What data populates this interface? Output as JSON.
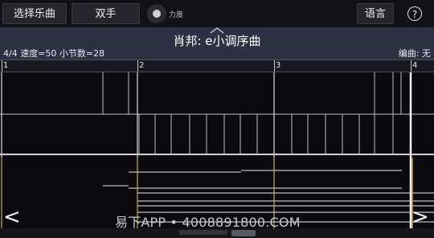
{
  "toolbar": {
    "select_song": "选择乐曲",
    "hands": "双手",
    "force_label": "力度",
    "language": "语言",
    "help": "?"
  },
  "song": {
    "title": "肖邦: e小调序曲",
    "info": "4/4 速度=50 小节数=28",
    "arranger": "编曲: 无"
  },
  "measures": [
    "1",
    "2",
    "3",
    "4"
  ],
  "nav": {
    "prev": "<",
    "next": ">"
  },
  "watermark": "易下APP • 4008891800.COM"
}
